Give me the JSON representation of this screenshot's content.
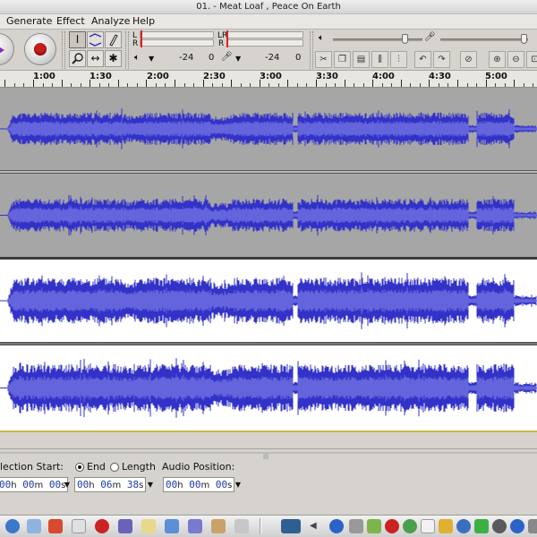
{
  "window": {
    "title": "01. - Meat Loaf , Peace On Earth"
  },
  "menu": {
    "generate": "Generate",
    "effect": "Effect",
    "analyze": "Analyze",
    "help": "Help"
  },
  "toolbar": {
    "meter_l": "L",
    "meter_r": "R",
    "lr_l": "LR",
    "lr_r": "R",
    "play_db": "-24",
    "play_zero": "0",
    "rec_db": "-24",
    "rec_zero": "0",
    "play_volume": 0.8,
    "rec_volume": 0.95,
    "icons": {
      "play": "play-icon",
      "record": "record-icon",
      "select": "select-tool-icon",
      "envelope": "envelope-tool-icon",
      "draw": "draw-tool-icon",
      "zoom": "zoom-tool-icon",
      "timeshift": "timeshift-tool-icon",
      "multi": "multi-tool-icon"
    }
  },
  "ruler": {
    "labels": [
      "1:00",
      "1:30",
      "2:00",
      "2:30",
      "3:00",
      "3:30",
      "4:00",
      "4:30",
      "5:00"
    ]
  },
  "selection": {
    "start_label": "lection Start:",
    "end_label": "End",
    "length_label": "Length",
    "audio_position_label": "Audio Position:",
    "start": {
      "h": "00",
      "h_u": "h",
      "m": "00",
      "m_u": "m",
      "s": "00",
      "s_u": "s"
    },
    "end": {
      "h": "00",
      "h_u": "h",
      "m": "06",
      "m_u": "m",
      "s": "38",
      "s_u": "s"
    },
    "audio_position": {
      "h": "00",
      "h_u": "h",
      "m": "00",
      "m_u": "m",
      "s": "00",
      "s_u": "s"
    }
  },
  "colors": {
    "waveform": "#3232c8",
    "waveform_rms": "#6464dc",
    "track_bg": "#a0a0a0",
    "selected_bg": "#ffffff",
    "record": "#c61d1d"
  }
}
